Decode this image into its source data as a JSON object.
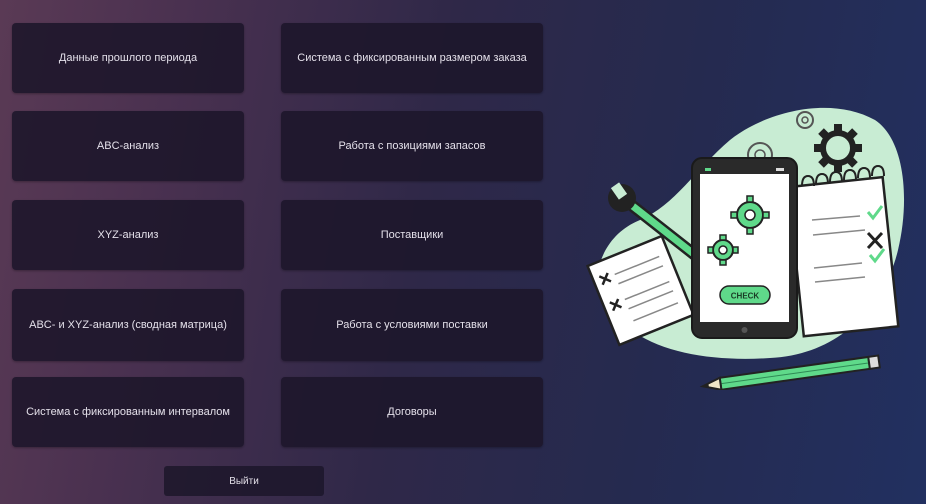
{
  "menu": {
    "past_period_data": "Данные прошлого периода",
    "fixed_order_size_system": "Система с фиксированным размером заказа",
    "abc_analysis": "ABC-анализ",
    "inventory_items": "Работа с позициями запасов",
    "xyz_analysis": "XYZ-анализ",
    "suppliers": "Поставщики",
    "abc_xyz_matrix": "ABC- и XYZ-анализ (сводная матрица)",
    "delivery_terms": "Работа с условиями поставки",
    "fixed_interval_system": "Система с фиксированным интервалом",
    "contracts": "Договоры"
  },
  "exit_label": "Выйти",
  "illustration": {
    "check_label": "CHECK"
  },
  "colors": {
    "accent_green": "#5fd98a",
    "light_green": "#c8ecd3",
    "button_bg": "#1c162a"
  }
}
